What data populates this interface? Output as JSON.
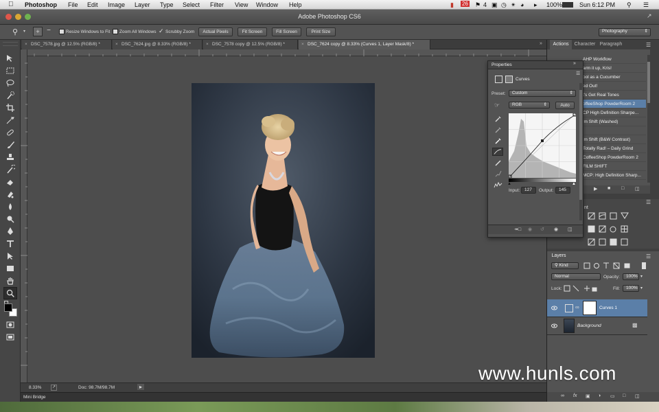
{
  "menubar": {
    "app": "Photoshop",
    "items": [
      "File",
      "Edit",
      "Image",
      "Layer",
      "Type",
      "Select",
      "Filter",
      "View",
      "Window",
      "Help"
    ],
    "status": {
      "adobe_badge": "26",
      "extra": "4",
      "battery": "100%",
      "clock": "Sun 6:12 PM"
    }
  },
  "window": {
    "title": "Adobe Photoshop CS6"
  },
  "options": {
    "resize_windows": "Resize Windows to Fit",
    "zoom_all": "Zoom All Windows",
    "scrubby": "Scrubby Zoom",
    "actual_pixels": "Actual Pixels",
    "fit_screen": "Fit Screen",
    "fill_screen": "Fill Screen",
    "print_size": "Print Size",
    "workspace": "Photography"
  },
  "tabs": [
    {
      "label": "DSC_7578.jpg @ 12.5% (RGB/8) *"
    },
    {
      "label": "DSC_7624.jpg @ 8.33% (RGB/8) *"
    },
    {
      "label": "DSC_7578 copy @ 12.5% (RGB/8) *"
    },
    {
      "label": "DSC_7624 copy @ 8.33% (Curves 1, Layer Mask/8) *"
    }
  ],
  "status": {
    "zoom": "8.33%",
    "doc": "Doc: 98.7M/98.7M"
  },
  "minibridge": {
    "label": "Mini Bridge"
  },
  "panels": {
    "top_tabs": [
      "Actions",
      "Character",
      "Paragraph"
    ],
    "actions": [
      "AHP Workflow",
      "arm it up, Kris!",
      "ool as a Cucumber",
      "ed Out!",
      "t's Get Real Tones",
      "offeeShop PowderRoom 2",
      "CP High Definition Sharpe...",
      "lm Shift (Washed)",
      "",
      "lm Shift (B&W Contrast)",
      "Totally Rad! – Daily Grind",
      "CoffeeShop PowderRoom 2",
      "FILM SHIFT",
      "MCP: High Definition Sharp..."
    ],
    "adjustments_fragment": "nt",
    "layers": {
      "title": "Layers",
      "kind": "Kind",
      "blend_mode": "Normal",
      "opacity_label": "Opacity:",
      "opacity": "100%",
      "lock_label": "Lock:",
      "fill_label": "Fill:",
      "fill": "100%",
      "rows": [
        {
          "name": "Curves 1"
        },
        {
          "name": "Background"
        }
      ]
    }
  },
  "properties": {
    "title": "Properties",
    "panel": "Curves",
    "preset_label": "Preset:",
    "preset": "Custom",
    "channel": "RGB",
    "auto": "Auto",
    "input_label": "Input:",
    "input": "127",
    "output_label": "Output:",
    "output": "145"
  },
  "watermark": "www.hunls.com",
  "colors": {
    "accent": "#5b7fa8",
    "ui_dark": "#3f3f3f",
    "ui_mid": "#535353"
  }
}
